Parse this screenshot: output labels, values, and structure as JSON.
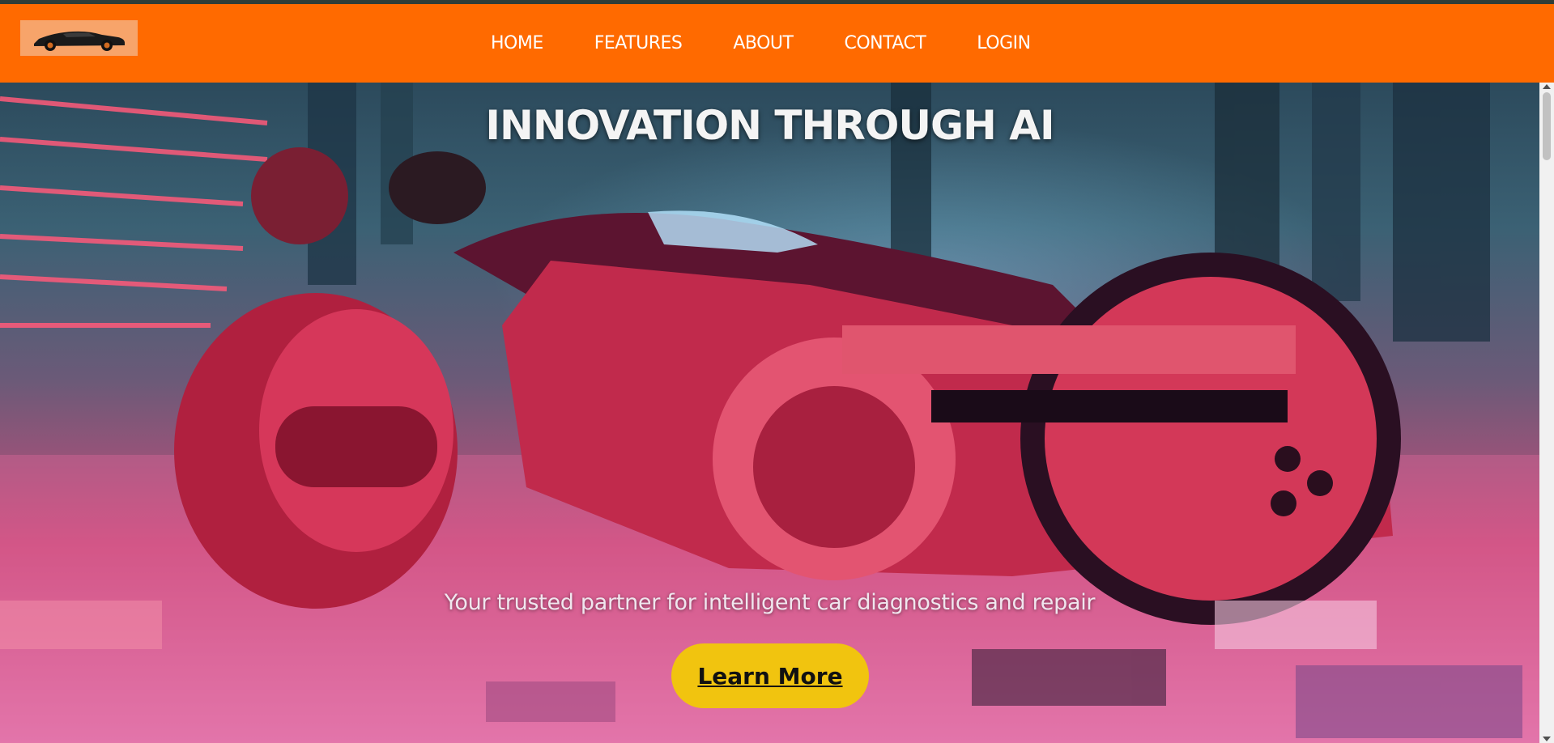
{
  "logo": {
    "icon": "sports-car-icon"
  },
  "nav": {
    "items": [
      {
        "label": "HOME"
      },
      {
        "label": "FEATURES"
      },
      {
        "label": "ABOUT"
      },
      {
        "label": "CONTACT"
      },
      {
        "label": "LOGIN"
      }
    ]
  },
  "hero": {
    "title": "INNOVATION THROUGH AI",
    "subtitle": "Your trusted partner for intelligent car diagnostics and repair",
    "cta_label": "Learn More",
    "image": "futuristic-motorbike-city-night"
  },
  "colors": {
    "nav_bg": "#ff6a00",
    "cta_bg": "#f1c40f",
    "logo_bg": "#f7a46a"
  }
}
